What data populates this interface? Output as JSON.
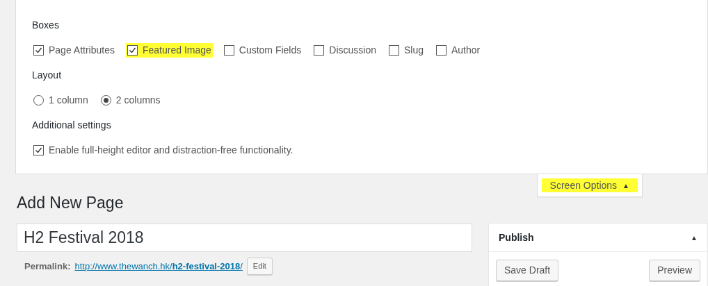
{
  "screen_options": {
    "sections": [
      {
        "heading": "Boxes",
        "kind": "checkboxes",
        "items": [
          {
            "label": "Page Attributes",
            "checked": true,
            "highlighted": false
          },
          {
            "label": "Featured Image",
            "checked": true,
            "highlighted": true
          },
          {
            "label": "Custom Fields",
            "checked": false,
            "highlighted": false
          },
          {
            "label": "Discussion",
            "checked": false,
            "highlighted": false
          },
          {
            "label": "Slug",
            "checked": false,
            "highlighted": false
          },
          {
            "label": "Author",
            "checked": false,
            "highlighted": false
          }
        ]
      },
      {
        "heading": "Layout",
        "kind": "radios",
        "items": [
          {
            "label": "1 column",
            "selected": false
          },
          {
            "label": "2 columns",
            "selected": true
          }
        ]
      },
      {
        "heading": "Additional settings",
        "kind": "checkboxes",
        "items": [
          {
            "label": "Enable full-height editor and distraction-free functionality.",
            "checked": true,
            "highlighted": false
          }
        ]
      }
    ],
    "toggle": {
      "label": "Screen Options",
      "arrow": "▲",
      "highlighted": true
    }
  },
  "page_title": "Add New Page",
  "title_field": {
    "value": "H2 Festival 2018"
  },
  "permalink": {
    "label": "Permalink:",
    "url": "http://www.thewanch.hk/**h2-festival-2018**/",
    "edit_button": "Edit"
  },
  "publish": {
    "title": "Publish",
    "arrow": "▲",
    "buttons": [
      "Save Draft",
      "Preview"
    ]
  }
}
